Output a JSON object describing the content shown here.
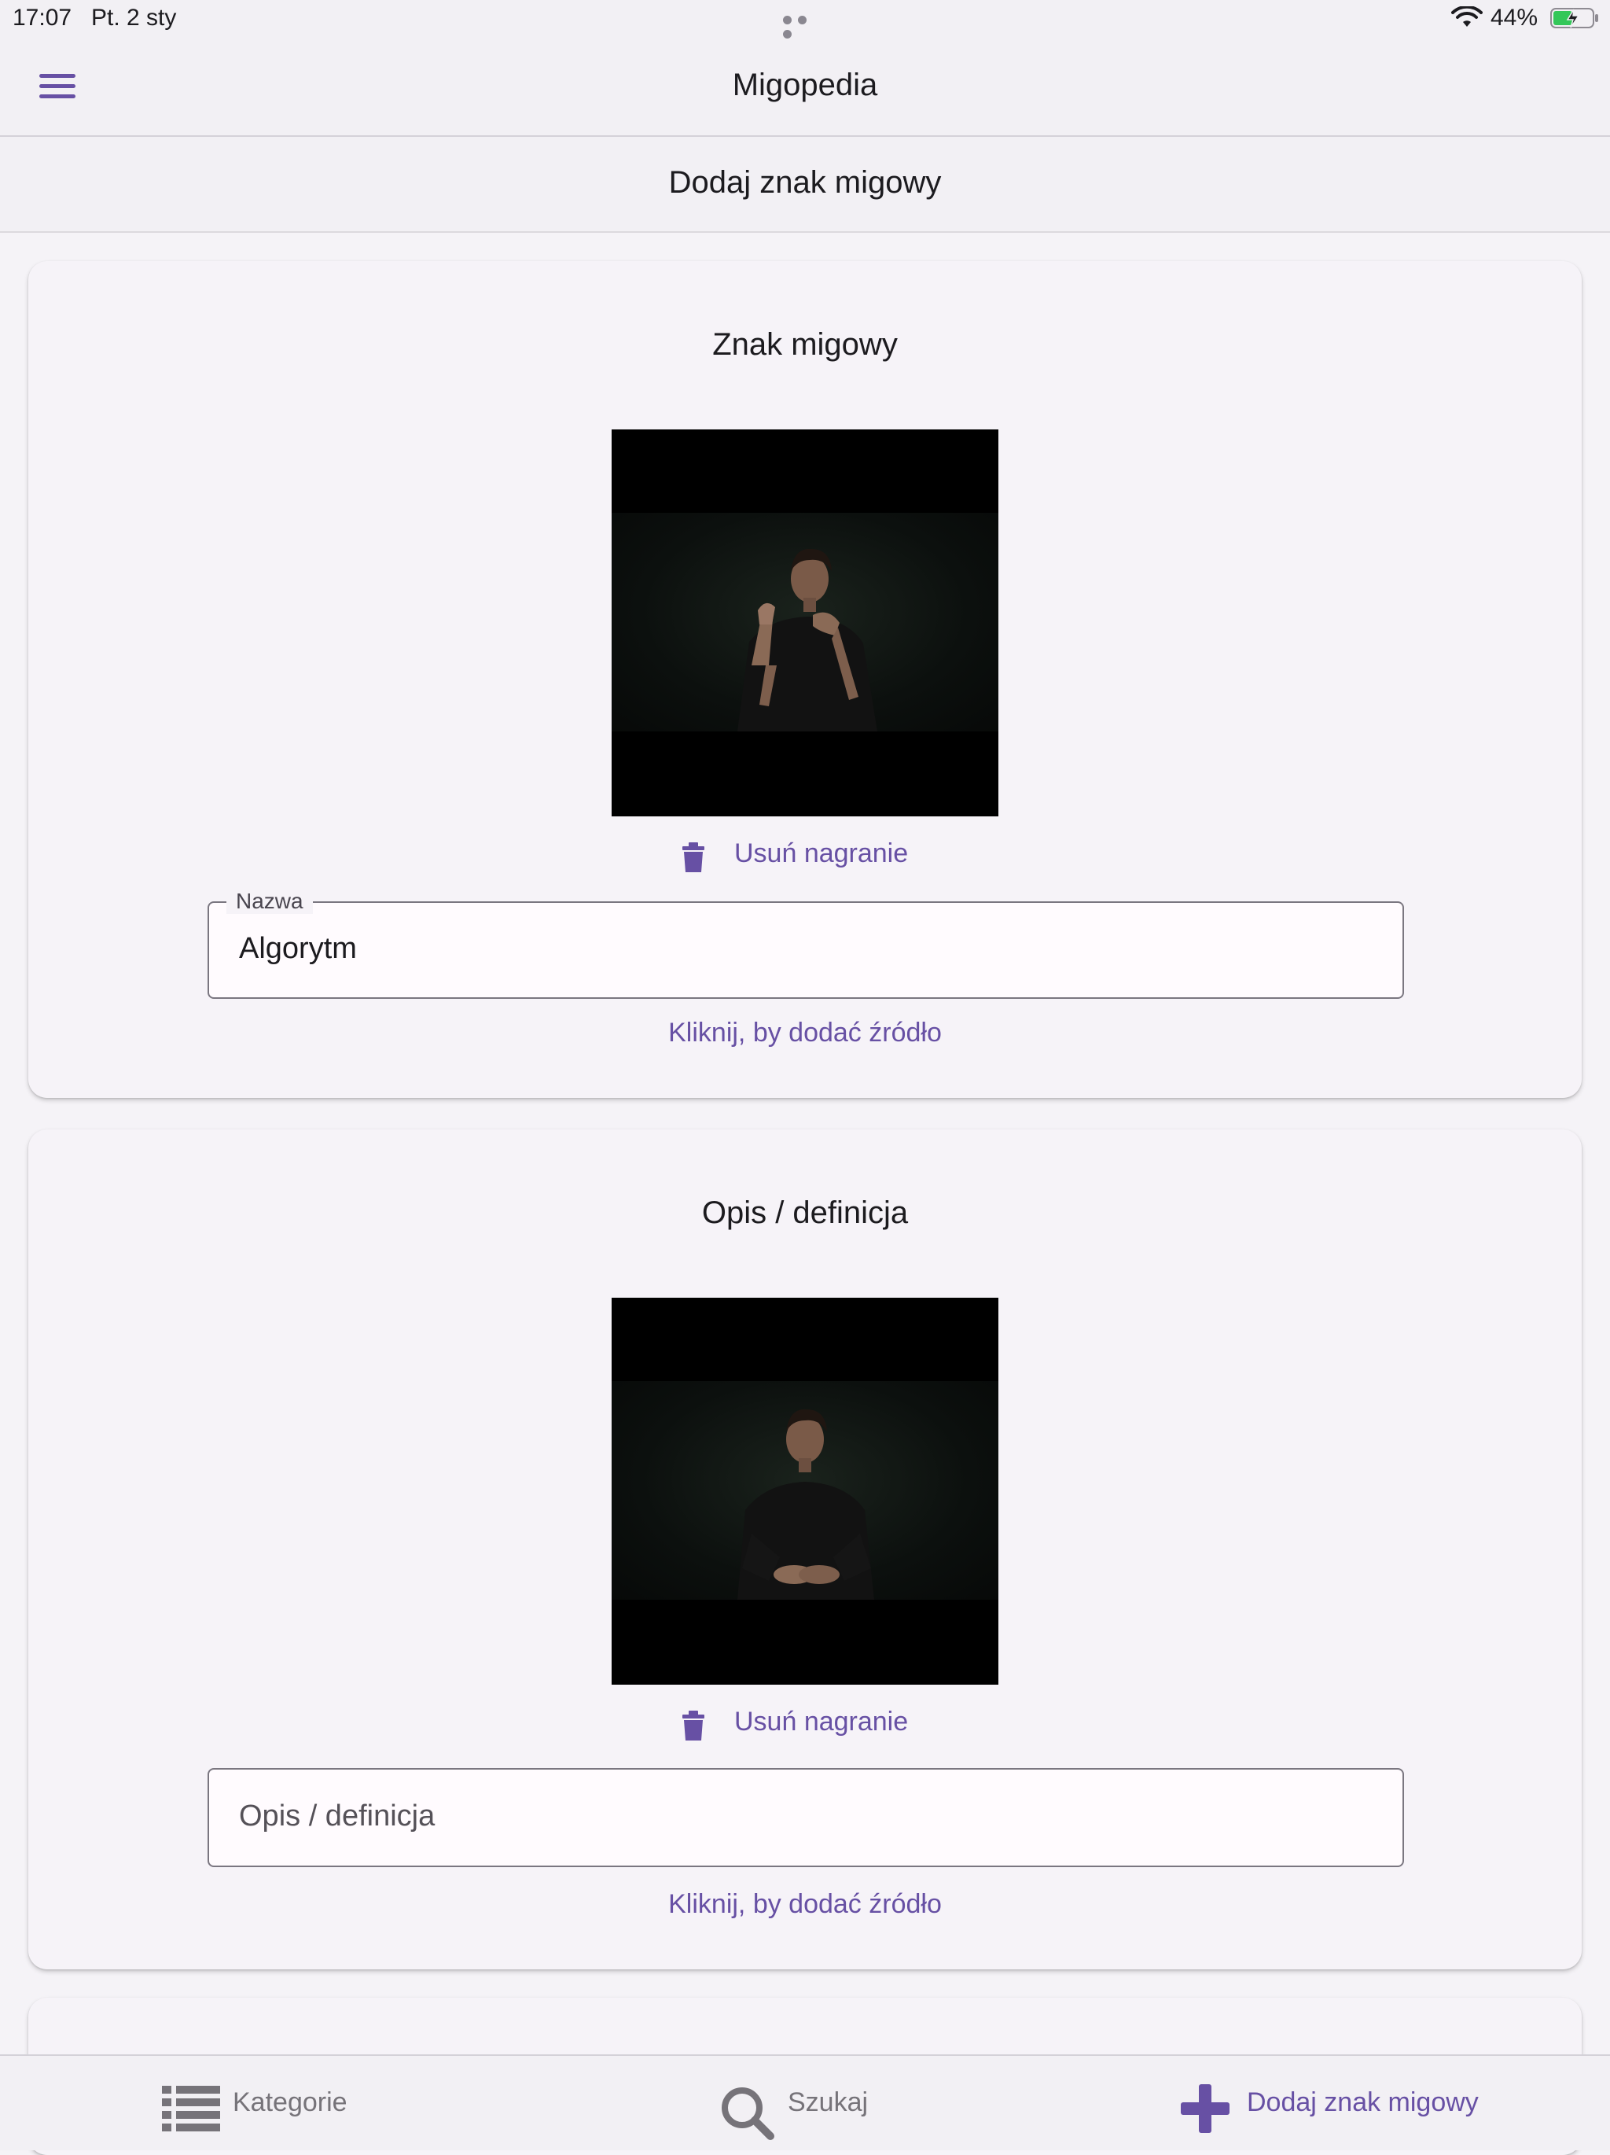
{
  "status_bar": {
    "time": "17:07",
    "date": "Pt. 2 sty",
    "battery": "44%",
    "battery_color": "#34c759"
  },
  "app_bar": {
    "title": "Migopedia",
    "menu_icon": "hamburger-menu-icon"
  },
  "page": {
    "title": "Dodaj znak migowy"
  },
  "sign_card": {
    "title": "Znak migowy",
    "video_icon": "video-preview",
    "remove_label": "Usuń nagranie",
    "remove_icon": "trash-icon",
    "name_field": {
      "label": "Nazwa",
      "value": "Algorytm"
    },
    "source_link": "Kliknij, by dodać źródło"
  },
  "definition_card": {
    "title": "Opis / definicja",
    "video_icon": "video-preview",
    "remove_label": "Usuń nagranie",
    "remove_icon": "trash-icon",
    "description_field": {
      "placeholder": "Opis / definicja",
      "value": ""
    },
    "source_link": "Kliknij, by dodać źródło"
  },
  "bottom_nav": {
    "items": [
      {
        "label": "Kategorie",
        "icon": "list-icon",
        "active": false
      },
      {
        "label": "Szukaj",
        "icon": "search-icon",
        "active": false
      },
      {
        "label": "Dodaj znak migowy",
        "icon": "plus-icon",
        "active": true
      }
    ]
  },
  "colors": {
    "accent": "#6750a4",
    "inactive": "#767379",
    "background": "#f5f3f7"
  }
}
